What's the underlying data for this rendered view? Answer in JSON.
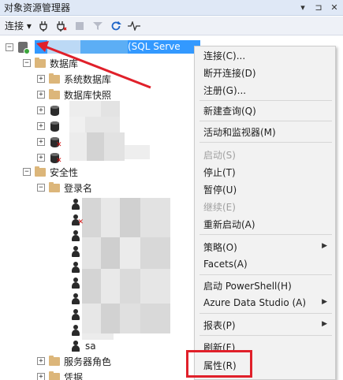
{
  "panel": {
    "title": "对象资源管理器",
    "title_buttons": [
      "▾",
      "⊐",
      "✕"
    ]
  },
  "toolbar": {
    "connect_label": "连接",
    "connect_arrow": "▾"
  },
  "tree": {
    "server_suffix": "(SQL Serve",
    "databases": "数据库",
    "system_databases": "系统数据库",
    "db_snapshots": "数据库快照",
    "security": "安全性",
    "logins": "登录名",
    "login_sa": "sa",
    "server_roles": "服务器角色",
    "credentials": "凭据"
  },
  "context_menu": {
    "items": [
      {
        "label": "连接(C)...",
        "enabled": true
      },
      {
        "label": "断开连接(D)",
        "enabled": true
      },
      {
        "label": "注册(G)...",
        "enabled": true
      },
      {
        "label": "新建查询(Q)",
        "enabled": true
      },
      {
        "label": "活动和监视器(M)",
        "enabled": true
      },
      {
        "label": "启动(S)",
        "enabled": false
      },
      {
        "label": "停止(T)",
        "enabled": true
      },
      {
        "label": "暂停(U)",
        "enabled": true
      },
      {
        "label": "继续(E)",
        "enabled": false
      },
      {
        "label": "重新启动(A)",
        "enabled": true
      },
      {
        "label": "策略(O)",
        "enabled": true,
        "submenu": true
      },
      {
        "label": "Facets(A)",
        "enabled": true
      },
      {
        "label": "启动 PowerShell(H)",
        "enabled": true
      },
      {
        "label": "Azure Data Studio (A)",
        "enabled": true,
        "submenu": true
      },
      {
        "label": "报表(P)",
        "enabled": true,
        "submenu": true
      },
      {
        "label": "刷新(F)",
        "enabled": true
      },
      {
        "label": "属性(R)",
        "enabled": true
      }
    ],
    "submenu_arrow": "▶"
  },
  "colors": {
    "selection": "#3399ff",
    "highlight": "#e0202a",
    "menu_bg": "#f2f2f2"
  }
}
